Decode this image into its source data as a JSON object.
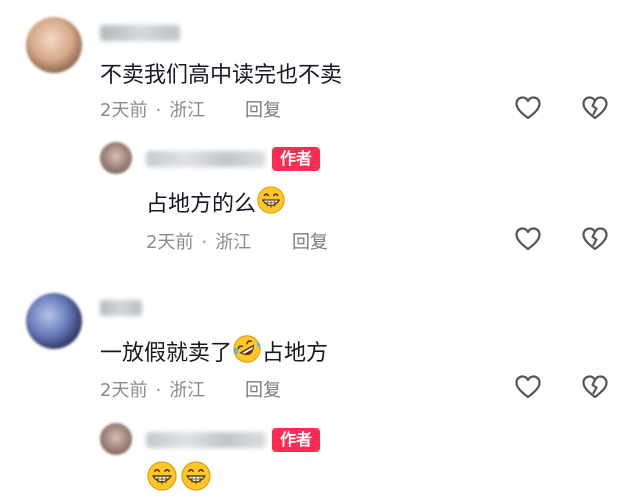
{
  "comments": [
    {
      "text": "不卖我们高中读完也不卖",
      "time": "2天前",
      "location": "浙江",
      "reply_label": "回复"
    },
    {
      "text": "占地方的么",
      "time": "2天前",
      "location": "浙江",
      "reply_label": "回复",
      "badge": "作者"
    },
    {
      "text_before": "一放假就卖了",
      "text_after": "占地方",
      "time": "2天前",
      "location": "浙江",
      "reply_label": "回复"
    },
    {
      "badge": "作者"
    }
  ],
  "separator": "·",
  "icons": {
    "like": "heart-outline-icon",
    "dislike": "broken-heart-icon"
  },
  "colors": {
    "author_badge": "#fe2c55",
    "meta_text": "#8a8b91",
    "body_text": "#161823",
    "icon_stroke": "#555555"
  }
}
